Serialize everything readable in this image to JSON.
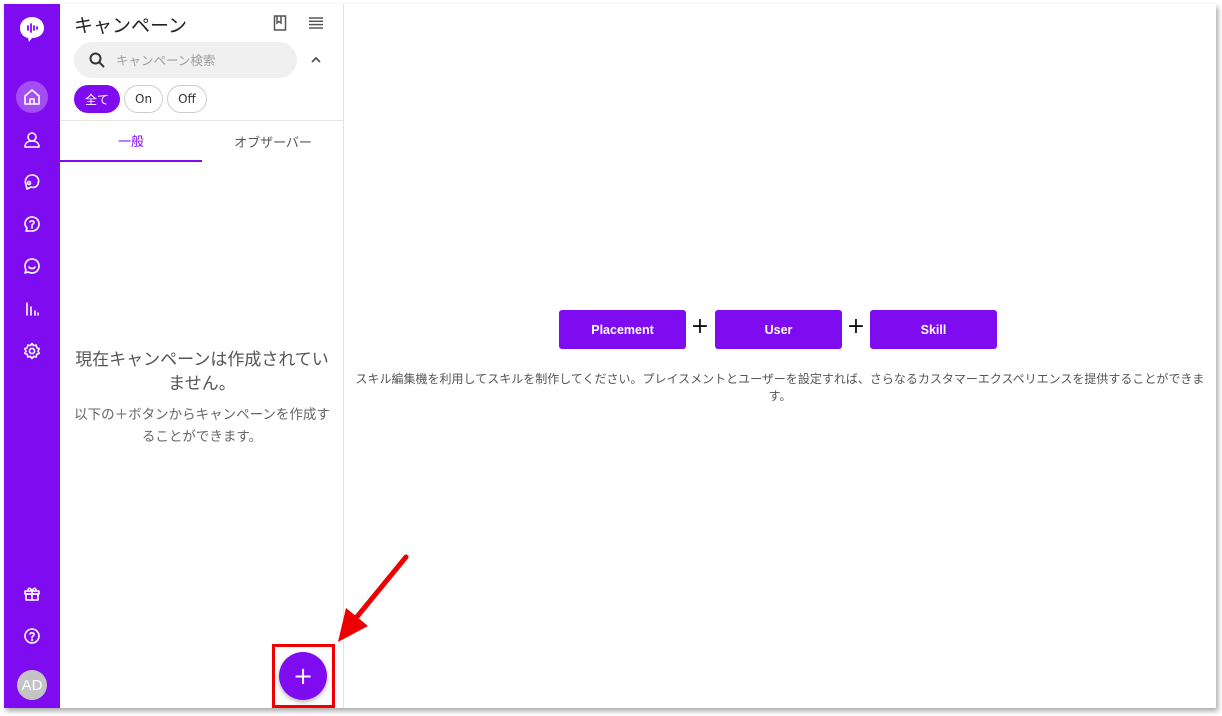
{
  "rail": {
    "logo": "chat-logo-icon",
    "items": [
      "home-icon",
      "user-icon",
      "conversation-icon",
      "help-bubble-icon",
      "chat-icon",
      "analytics-icon",
      "settings-icon"
    ],
    "bottom": [
      "gift-icon",
      "help-icon"
    ],
    "avatar": "AD",
    "colors": {
      "accent": "#7f0bf0"
    }
  },
  "panel": {
    "title": "キャンペーン",
    "search_placeholder": "キャンペーン検索",
    "filters": [
      "全て",
      "On",
      "Off"
    ],
    "active_filter": "全て",
    "tabs": [
      "一般",
      "オブザーバー"
    ],
    "active_tab": "一般",
    "empty_title": "現在キャンペーンは作成されていません。",
    "empty_sub": "以下の＋ボタンからキャンペーンを作成することができます。",
    "fab_label": "+"
  },
  "main": {
    "blocks": [
      "Placement",
      "User",
      "Skill"
    ],
    "joiner": "+",
    "description": "スキル編集機を利用してスキルを制作してください。プレイスメントとユーザーを設定すれば、さらなるカスタマーエクスペリエンスを提供することができます。"
  }
}
